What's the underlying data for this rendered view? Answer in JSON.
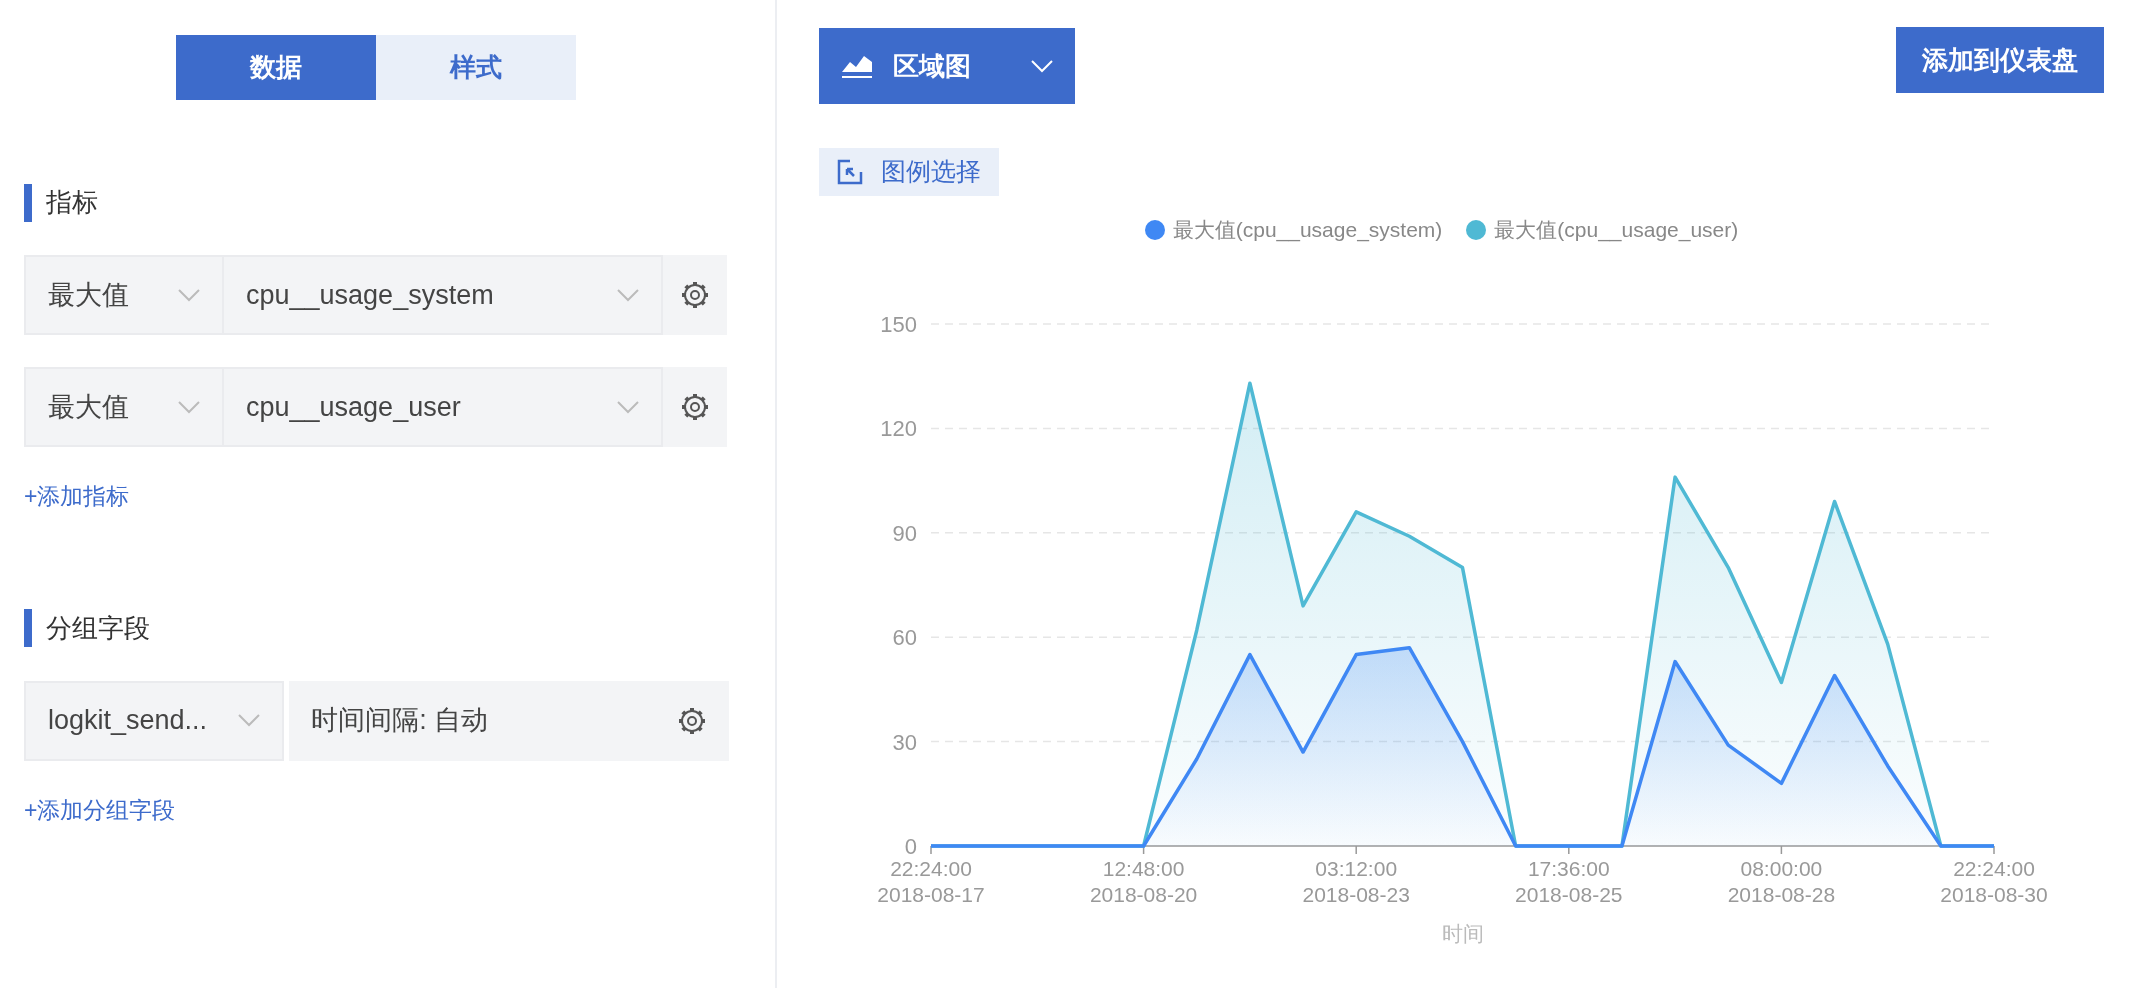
{
  "mode_tabs": [
    {
      "label": "数据",
      "selected": true
    },
    {
      "label": "样式",
      "selected": false
    }
  ],
  "metrics": {
    "title": "指标",
    "rows": [
      {
        "aggregate": "最大值",
        "field": "cpu__usage_system"
      },
      {
        "aggregate": "最大值",
        "field": "cpu__usage_user"
      }
    ],
    "add_link": "+添加指标"
  },
  "group_fields": {
    "title": "分组字段",
    "rows": [
      {
        "field": "logkit_send...",
        "interval": "时间间隔: 自动"
      }
    ],
    "add_link": "+添加分组字段"
  },
  "chart_type": {
    "label": "区域图"
  },
  "add_to_dashboard": "添加到仪表盘",
  "legend_select": "图例选择",
  "chart_data": {
    "type": "area",
    "xlabel": "时间",
    "categories": [
      "22:24:00\n2018-08-17",
      null,
      null,
      null,
      "12:48:00\n2018-08-20",
      null,
      null,
      null,
      "03:12:00\n2018-08-23",
      null,
      null,
      null,
      "17:36:00\n2018-08-25",
      null,
      null,
      null,
      "08:00:00\n2018-08-28",
      null,
      null,
      null,
      "22:24:00\n2018-08-30"
    ],
    "series": [
      {
        "name": "最大值(cpu__usage_system)",
        "color": "#3f88f4",
        "values": [
          0,
          0,
          0,
          0,
          0,
          25,
          55,
          27,
          55,
          57,
          30,
          0,
          0,
          0,
          53,
          29,
          18,
          49,
          23,
          0,
          0
        ]
      },
      {
        "name": "最大值(cpu__usage_user)",
        "color": "#4fb9d4",
        "values": [
          0,
          0,
          0,
          0,
          0,
          62,
          133,
          69,
          96,
          89,
          80,
          0,
          0,
          0,
          106,
          80,
          47,
          99,
          58,
          0,
          0
        ]
      }
    ],
    "ylim": [
      0,
      150
    ],
    "yticks": [
      0,
      30,
      60,
      90,
      120,
      150
    ],
    "stacked": false,
    "grid": true
  }
}
